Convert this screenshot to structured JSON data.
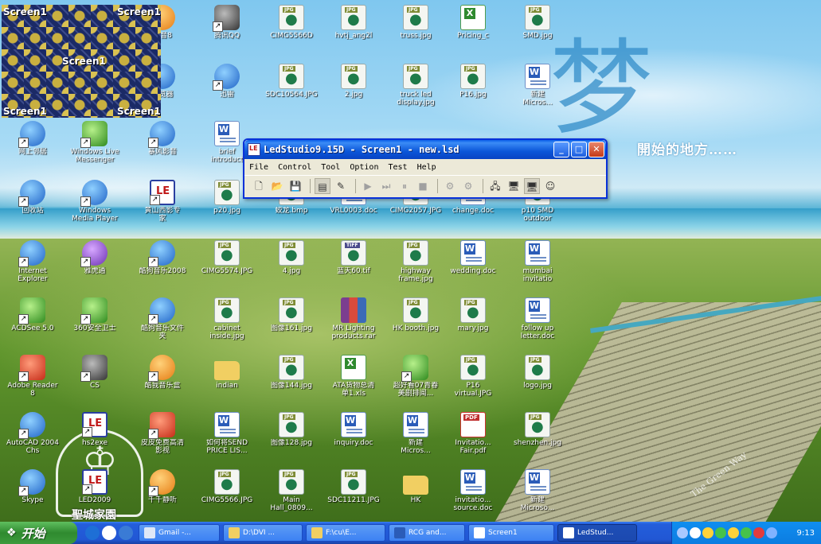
{
  "wallpaper": {
    "big_char": "梦",
    "slogan": "開始的地方……",
    "tag": "The Green Way",
    "crest_label": "聖城家園"
  },
  "screen1_preview": {
    "tags": [
      "Screen1",
      "Screen1",
      "Screen1",
      "Screen1",
      "Screen1"
    ]
  },
  "desktop_icons": [
    {
      "label": "播音8",
      "type": "app-orange"
    },
    {
      "label": "腾讯QQ",
      "type": "app-dark"
    },
    {
      "label": "CIMG5566D",
      "type": "jpg"
    },
    {
      "label": "hvtj_ang2l",
      "type": "jpg"
    },
    {
      "label": "truss.jpg",
      "type": "jpg"
    },
    {
      "label": "Pricing_c",
      "type": "xls"
    },
    {
      "label": "SMD.jpg",
      "type": "jpg"
    },
    {
      "label": "浏览器",
      "type": "app"
    },
    {
      "label": "迅雷",
      "type": "app"
    },
    {
      "label": "SDC10564.JPG",
      "type": "jpg"
    },
    {
      "label": "2.jpg",
      "type": "jpg"
    },
    {
      "label": "truck led\ndisplay.jpg",
      "type": "jpg"
    },
    {
      "label": "P16.jpg",
      "type": "jpg"
    },
    {
      "label": "新建\nMicros...",
      "type": "doc"
    },
    {
      "label": "网上邻居",
      "type": "app"
    },
    {
      "label": "Windows Live\nMessenger",
      "type": "app-green"
    },
    {
      "label": "暴风影音",
      "type": "app"
    },
    {
      "label": "brief\nintroduct",
      "type": "doc"
    },
    {
      "label": "回收站",
      "type": "app"
    },
    {
      "label": "Windows\nMedia Player",
      "type": "app"
    },
    {
      "label": "黄山西影专\n家",
      "type": "app-led"
    },
    {
      "label": "p20.jpg",
      "type": "jpg"
    },
    {
      "label": "蛟龙.bmp",
      "type": "jpg"
    },
    {
      "label": "VRL0003.doc",
      "type": "doc"
    },
    {
      "label": "CIMG2057.JPG",
      "type": "jpg"
    },
    {
      "label": "change.doc",
      "type": "doc"
    },
    {
      "label": "p10 SMD\noutdoor",
      "type": "jpg"
    },
    {
      "label": "Internet\nExplorer",
      "type": "app"
    },
    {
      "label": "雅虎通",
      "type": "app-purple"
    },
    {
      "label": "酷狗音乐2008",
      "type": "app"
    },
    {
      "label": "CIMG5574.JPG",
      "type": "jpg"
    },
    {
      "label": "4.jpg",
      "type": "jpg"
    },
    {
      "label": "蓝天60.tif",
      "type": "tif"
    },
    {
      "label": "highway\nframe.jpg",
      "type": "jpg"
    },
    {
      "label": "wedding.doc",
      "type": "doc"
    },
    {
      "label": "mumbai\ninvitatio",
      "type": "doc"
    },
    {
      "label": "ACDSee 5.0",
      "type": "app-green"
    },
    {
      "label": "360安全卫士",
      "type": "app-green"
    },
    {
      "label": "酷狗音乐文件\n夹",
      "type": "app"
    },
    {
      "label": "cabinet\ninside.jpg",
      "type": "jpg"
    },
    {
      "label": "图像161.jpg",
      "type": "jpg"
    },
    {
      "label": "MR Lighting\nproducts.rar",
      "type": "rar"
    },
    {
      "label": "HK booth.jpg",
      "type": "jpg"
    },
    {
      "label": "mary.jpg",
      "type": "jpg"
    },
    {
      "label": "follow up\nletter.doc",
      "type": "doc"
    },
    {
      "label": "Adobe Reader\n8",
      "type": "app-red"
    },
    {
      "label": "CS",
      "type": "app-dark"
    },
    {
      "label": "酷我音乐盒",
      "type": "app-orange"
    },
    {
      "label": "indian",
      "type": "folder"
    },
    {
      "label": "图像144.jpg",
      "type": "jpg"
    },
    {
      "label": "ATA货物总清\n单1.xls",
      "type": "xls"
    },
    {
      "label": "超好看07青春\n美剧排闻...",
      "type": "app-green"
    },
    {
      "label": "P16\nvirtual.JPG",
      "type": "jpg"
    },
    {
      "label": "logo.jpg",
      "type": "jpg"
    },
    {
      "label": "AutoCAD 2004\nChs",
      "type": "app"
    },
    {
      "label": "hs2exe",
      "type": "app-led"
    },
    {
      "label": "皮皮免费高清\n影视",
      "type": "app-red"
    },
    {
      "label": "如何将SEND\nPRICE LIS...",
      "type": "doc"
    },
    {
      "label": "图像128.jpg",
      "type": "jpg"
    },
    {
      "label": "inquiry.doc",
      "type": "doc"
    },
    {
      "label": "新建\nMicros...",
      "type": "doc"
    },
    {
      "label": "Invitatio...\nFair.pdf",
      "type": "pdf"
    },
    {
      "label": "shenzhen.jpg",
      "type": "jpg"
    },
    {
      "label": "Skype",
      "type": "app"
    },
    {
      "label": "LED2009",
      "type": "app-led"
    },
    {
      "label": "千千静听",
      "type": "app-orange"
    },
    {
      "label": "CIMG5566.JPG",
      "type": "jpg"
    },
    {
      "label": "Main\nHall_0809...",
      "type": "jpg"
    },
    {
      "label": "SDC11211.JPG",
      "type": "jpg"
    },
    {
      "label": "HK",
      "type": "folder"
    },
    {
      "label": "invitatio...\nsource.doc",
      "type": "doc"
    },
    {
      "label": "新建\nMicroso...",
      "type": "doc"
    }
  ],
  "window": {
    "title": "LedStudio9.15D - Screen1 - new.lsd",
    "buttons": {
      "minimize": "_",
      "maximize": "□",
      "close": "✕"
    },
    "menu": [
      "File",
      "Control",
      "Tool",
      "Option",
      "Test",
      "Help"
    ],
    "toolbar": [
      {
        "icon": "new-file-icon",
        "glyph": "🗋",
        "state": "normal"
      },
      {
        "icon": "open-folder-icon",
        "glyph": "📂",
        "state": "normal"
      },
      {
        "icon": "save-icon",
        "glyph": "💾",
        "state": "normal"
      },
      {
        "icon": "screen-icon",
        "glyph": "▤",
        "state": "on"
      },
      {
        "icon": "magic-wand-icon",
        "glyph": "✎",
        "state": "normal"
      },
      {
        "icon": "play-icon",
        "glyph": "▶",
        "state": "disabled"
      },
      {
        "icon": "step-icon",
        "glyph": "⏭",
        "state": "disabled"
      },
      {
        "icon": "pause-icon",
        "glyph": "⏸",
        "state": "disabled"
      },
      {
        "icon": "stop-icon",
        "glyph": "■",
        "state": "disabled"
      },
      {
        "icon": "send-icon",
        "glyph": "⚙",
        "state": "disabled"
      },
      {
        "icon": "receive-icon",
        "glyph": "⚙",
        "state": "disabled"
      },
      {
        "icon": "network-icon",
        "glyph": "🖧",
        "state": "normal"
      },
      {
        "icon": "monitor-red-icon",
        "glyph": "🖥",
        "state": "normal"
      },
      {
        "icon": "monitor-active-icon",
        "glyph": "🖥",
        "state": "on"
      },
      {
        "icon": "smiley-icon",
        "glyph": "☺",
        "state": "normal"
      }
    ]
  },
  "taskbar": {
    "start_label": "开始",
    "quick_launch": [
      "ie-icon",
      "media-icon",
      "browser-icon"
    ],
    "tasks": [
      {
        "label": "Gmail -...",
        "icon": "chrome-icon",
        "active": false
      },
      {
        "label": "D:\\DVI ...",
        "icon": "folder-icon",
        "active": false
      },
      {
        "label": "F:\\cu\\E...",
        "icon": "folder-icon",
        "active": false
      },
      {
        "label": "RCG and...",
        "icon": "word-icon",
        "active": false
      },
      {
        "label": "Screen1",
        "icon": "ledstudio-icon",
        "active": false
      },
      {
        "label": "LedStud...",
        "icon": "ledstudio-icon",
        "active": true
      }
    ],
    "tray_icons": [
      "network-icon",
      "volume-icon",
      "qq-icon",
      "messenger-icon",
      "smiley-icon",
      "antivirus-icon",
      "k-icon",
      "display-icon"
    ],
    "clock": "9:13"
  }
}
